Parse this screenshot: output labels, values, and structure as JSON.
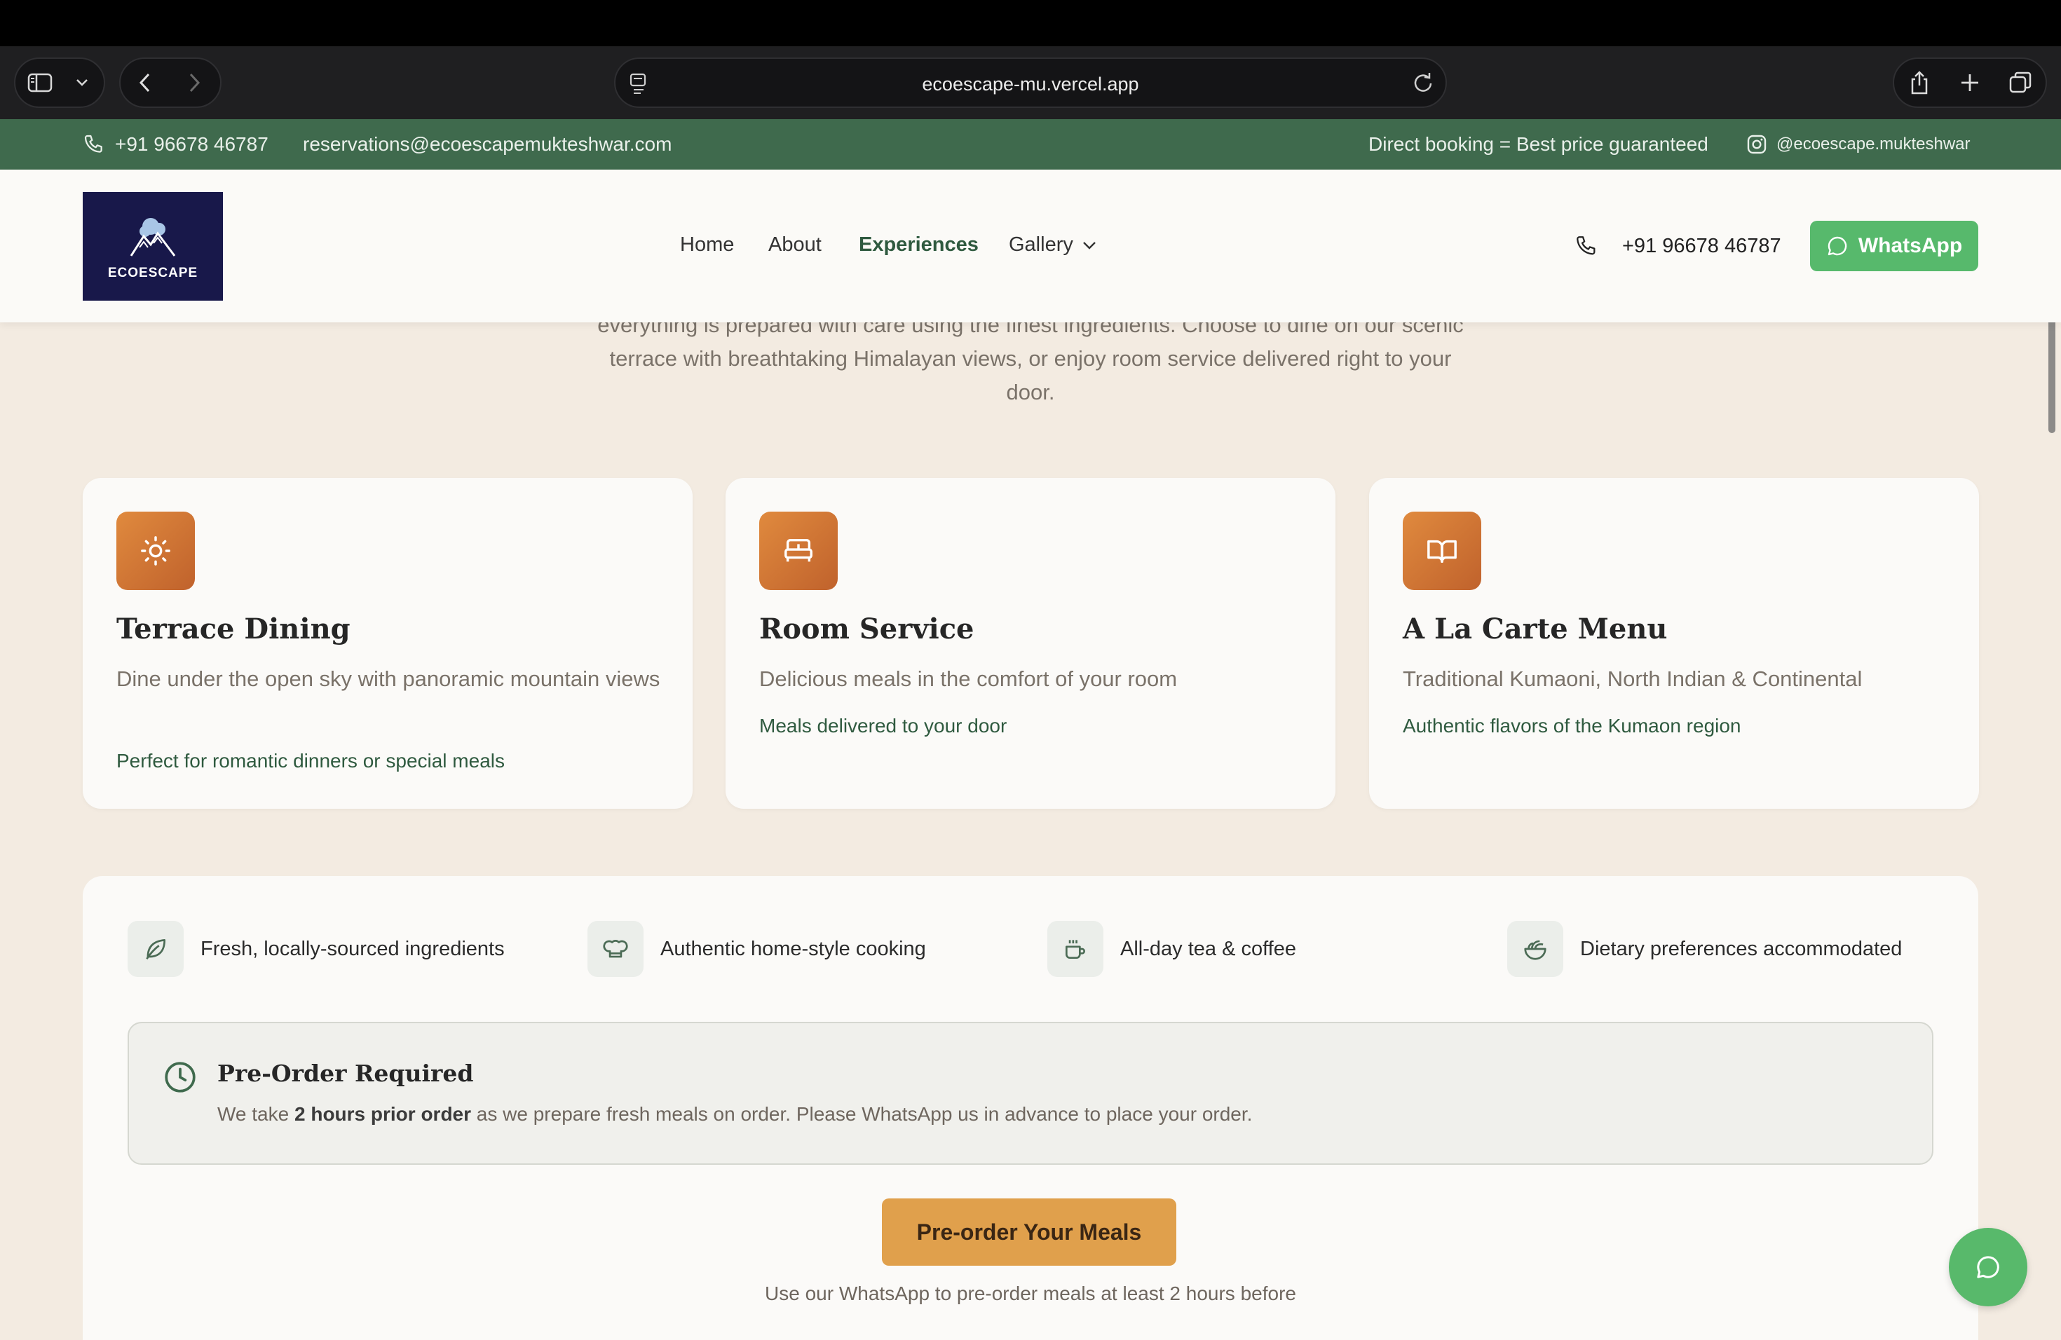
{
  "browser": {
    "url": "ecoescape-mu.vercel.app"
  },
  "infobar": {
    "phone": "+91 96678 46787",
    "email": "reservations@ecoescapemukteshwar.com",
    "promo": "Direct booking = Best price guaranteed",
    "instagram": "@ecoescape.mukteshwar"
  },
  "header": {
    "logo_text": "ECOESCAPE",
    "nav": [
      "Home",
      "About",
      "Experiences",
      "Gallery"
    ],
    "active_nav": "Experiences",
    "phone": "+91 96678 46787",
    "whatsapp_label": "WhatsApp"
  },
  "intro": {
    "line1": "everything is prepared with care using the finest ingredients. Choose to dine on our scenic",
    "line2": "terrace with breathtaking Himalayan views, or enjoy room service delivered right to your",
    "line3": "door."
  },
  "cards": [
    {
      "icon": "sun-icon",
      "title": "Terrace Dining",
      "desc": "Dine under the open sky with panoramic mountain views",
      "note": "Perfect for romantic dinners or special meals"
    },
    {
      "icon": "bed-icon",
      "title": "Room Service",
      "desc": "Delicious meals in the comfort of your room",
      "note": "Meals delivered to your door"
    },
    {
      "icon": "book-icon",
      "title": "A La Carte Menu",
      "desc": "Traditional Kumaoni, North Indian & Continental",
      "note": "Authentic flavors of the Kumaon region"
    }
  ],
  "features": [
    {
      "icon": "leaf-icon",
      "label": "Fresh, locally-sourced ingredients"
    },
    {
      "icon": "chef-hat-icon",
      "label": "Authentic home-style cooking"
    },
    {
      "icon": "coffee-icon",
      "label": "All-day tea & coffee"
    },
    {
      "icon": "salad-icon",
      "label": "Dietary preferences accommodated"
    }
  ],
  "notice": {
    "title": "Pre-Order Required",
    "text_before": "We take ",
    "text_bold": "2 hours prior order",
    "text_after": " as we prepare fresh meals on order. Please WhatsApp us in advance to place your order."
  },
  "cta": {
    "label": "Pre-order Your Meals",
    "sub": "Use our WhatsApp to pre-order meals at least 2 hours before"
  },
  "colors": {
    "brand_green": "#3f6a4d",
    "whatsapp_green": "#57b96c",
    "accent_orange": "#e0a04c",
    "background": "#f3ebe1"
  }
}
